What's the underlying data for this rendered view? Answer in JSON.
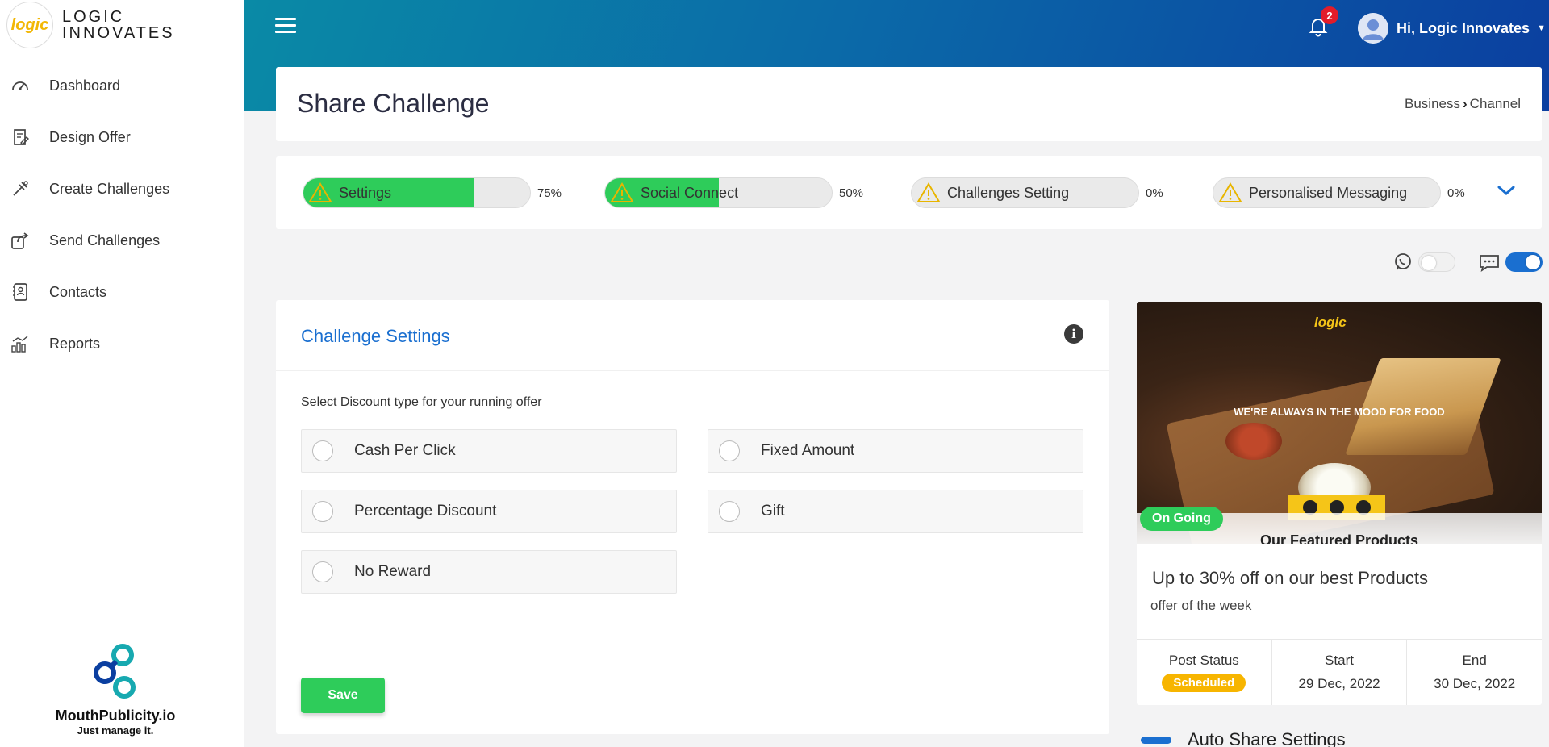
{
  "brand": {
    "logo_text": "logic",
    "name_line1": "LOGIC",
    "name_line2": "INNOVATES"
  },
  "sidebar": {
    "items": [
      {
        "label": "Dashboard",
        "icon": "dashboard-gauge-icon"
      },
      {
        "label": "Design Offer",
        "icon": "design-offer-icon"
      },
      {
        "label": "Create Challenges",
        "icon": "create-challenges-icon"
      },
      {
        "label": "Send Challenges",
        "icon": "send-share-icon"
      },
      {
        "label": "Contacts",
        "icon": "contacts-icon"
      },
      {
        "label": "Reports",
        "icon": "reports-chart-icon"
      }
    ],
    "footer": {
      "title": "MouthPublicity.io",
      "subtitle": "Just manage it."
    }
  },
  "header": {
    "notifications_count": "2",
    "user_greeting": "Hi, Logic Innovates",
    "gradient_colors": [
      "#0a8aa6",
      "#0b3fa0"
    ]
  },
  "page": {
    "title": "Share Challenge",
    "breadcrumb": {
      "parent": "Business",
      "current": "Channel"
    }
  },
  "progress_steps": [
    {
      "label": "Settings",
      "percent_text": "75%",
      "progress": 0.75
    },
    {
      "label": "Social Connect",
      "percent_text": "50%",
      "progress": 0.5
    },
    {
      "label": "Challenges Setting",
      "percent_text": "0%",
      "progress": 0
    },
    {
      "label": "Personalised Messaging",
      "percent_text": "0%",
      "progress": 0
    }
  ],
  "channels": {
    "whatsapp": {
      "icon": "whatsapp-icon",
      "enabled": false
    },
    "sms": {
      "icon": "message-bubble-icon",
      "enabled": true
    }
  },
  "challenge_settings": {
    "title": "Challenge Settings",
    "prompt": "Select Discount type for your running offer",
    "options": [
      "Cash Per Click",
      "Fixed Amount",
      "Percentage Discount",
      "Gift",
      "No Reward"
    ],
    "save_label": "Save"
  },
  "offer": {
    "image_logo": "logic",
    "image_tagline": "WE'RE ALWAYS IN THE MOOD FOR FOOD",
    "image_caption": "Our Featured Products",
    "status_badge": "On Going",
    "title": "Up to 30% off on our best Products",
    "subtitle": "offer of the week",
    "post_status_label": "Post Status",
    "post_status_value": "Scheduled",
    "start_label": "Start",
    "start_value": "29 Dec, 2022",
    "end_label": "End",
    "end_value": "30 Dec, 2022"
  },
  "auto_share": {
    "label": "Auto Share Settings"
  },
  "colors": {
    "accent_blue": "#1a6fd0",
    "success_green": "#2ecc5a",
    "warning_yellow": "#f7b500",
    "badge_red": "#e21c2a"
  }
}
